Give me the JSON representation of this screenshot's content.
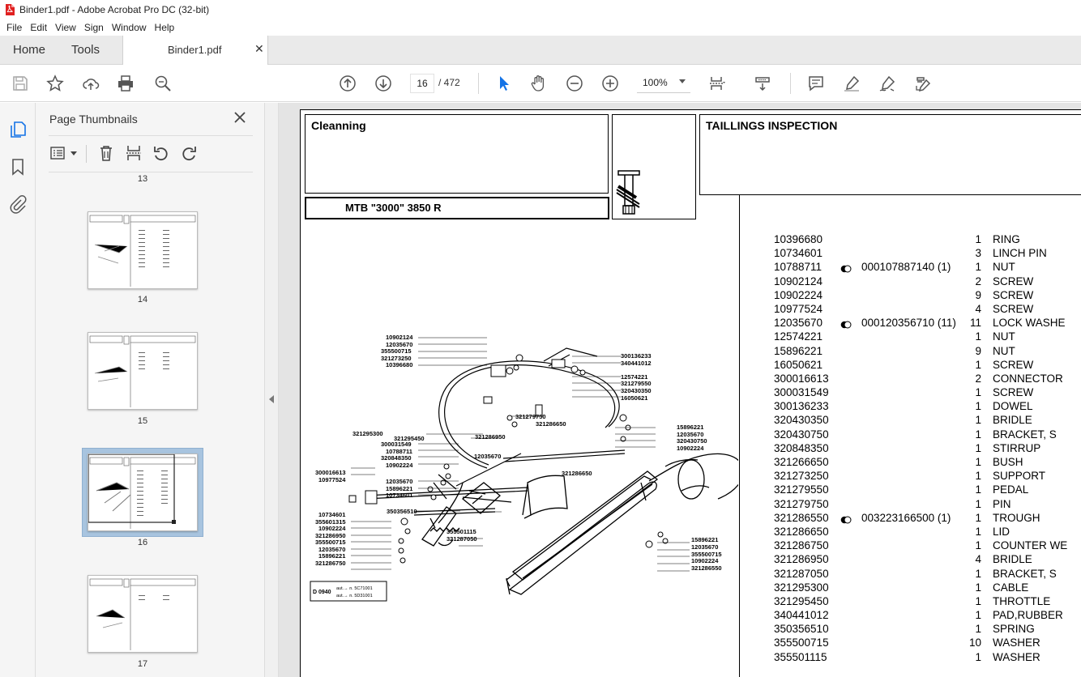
{
  "window": {
    "title": "Binder1.pdf - Adobe Acrobat Pro DC (32-bit)"
  },
  "menu": [
    "File",
    "Edit",
    "View",
    "Sign",
    "Window",
    "Help"
  ],
  "tabs": {
    "home": "Home",
    "tools": "Tools",
    "document": "Binder1.pdf"
  },
  "toolbar": {
    "current_page": "16",
    "page_of": "/  472",
    "zoom": "100%"
  },
  "panel": {
    "title": "Page Thumbnails",
    "thumbnails": [
      {
        "label": "13"
      },
      {
        "label": "14"
      },
      {
        "label": "15"
      },
      {
        "label": "16",
        "selected": true
      },
      {
        "label": "17"
      }
    ]
  },
  "document": {
    "header_left": "Cleanning",
    "header_right": "TAILLINGS INSPECTION",
    "model": "MTB \"3000\" 3850 R",
    "diagram_code": "D 0940",
    "diagram_notes": [
      "aut.→ n. 5C71001",
      "aut.→ n. 5D31001"
    ],
    "diagram_labels": [
      "10902124",
      "12035670",
      "355500715",
      "321273250",
      "10396680",
      "300136233",
      "340441012",
      "12574221",
      "321279550",
      "320430350",
      "16050621",
      "321279750",
      "321286650",
      "321295300",
      "321295450",
      "321286950",
      "12035670",
      "15896221",
      "12035670",
      "320430750",
      "10902224",
      "300031549",
      "10788711",
      "320848350",
      "10902224",
      "300016613",
      "10977524",
      "12035670",
      "15896221",
      "10734601",
      "321286650",
      "350356510",
      "10734601",
      "355601315",
      "10902224",
      "321286950",
      "355500715",
      "12035670",
      "15896221",
      "321286750",
      "355501115",
      "321287050",
      "15896221",
      "12035670",
      "355500715",
      "10902224",
      "321286550"
    ],
    "parts": [
      {
        "num": "10396680",
        "marker": false,
        "ref": "",
        "qty": "1",
        "desc": "RING"
      },
      {
        "num": "10734601",
        "marker": false,
        "ref": "",
        "qty": "3",
        "desc": "LINCH PIN"
      },
      {
        "num": "10788711",
        "marker": true,
        "ref": "000107887140  (1)",
        "qty": "1",
        "desc": "NUT"
      },
      {
        "num": "10902124",
        "marker": false,
        "ref": "",
        "qty": "2",
        "desc": "SCREW"
      },
      {
        "num": "10902224",
        "marker": false,
        "ref": "",
        "qty": "9",
        "desc": "SCREW"
      },
      {
        "num": "10977524",
        "marker": false,
        "ref": "",
        "qty": "4",
        "desc": "SCREW"
      },
      {
        "num": "12035670",
        "marker": true,
        "ref": "000120356710  (11)",
        "qty": "11",
        "desc": "LOCK WASHE"
      },
      {
        "num": "12574221",
        "marker": false,
        "ref": "",
        "qty": "1",
        "desc": "NUT"
      },
      {
        "num": "15896221",
        "marker": false,
        "ref": "",
        "qty": "9",
        "desc": "NUT"
      },
      {
        "num": "16050621",
        "marker": false,
        "ref": "",
        "qty": "1",
        "desc": "SCREW"
      },
      {
        "num": "300016613",
        "marker": false,
        "ref": "",
        "qty": "2",
        "desc": "CONNECTOR"
      },
      {
        "num": "300031549",
        "marker": false,
        "ref": "",
        "qty": "1",
        "desc": "SCREW"
      },
      {
        "num": "300136233",
        "marker": false,
        "ref": "",
        "qty": "1",
        "desc": "DOWEL"
      },
      {
        "num": "320430350",
        "marker": false,
        "ref": "",
        "qty": "1",
        "desc": "BRIDLE"
      },
      {
        "num": "320430750",
        "marker": false,
        "ref": "",
        "qty": "1",
        "desc": "BRACKET, S"
      },
      {
        "num": "320848350",
        "marker": false,
        "ref": "",
        "qty": "1",
        "desc": "STIRRUP"
      },
      {
        "num": "321266650",
        "marker": false,
        "ref": "",
        "qty": "1",
        "desc": "BUSH"
      },
      {
        "num": "321273250",
        "marker": false,
        "ref": "",
        "qty": "1",
        "desc": "SUPPORT"
      },
      {
        "num": "321279550",
        "marker": false,
        "ref": "",
        "qty": "1",
        "desc": "PEDAL"
      },
      {
        "num": "321279750",
        "marker": false,
        "ref": "",
        "qty": "1",
        "desc": "PIN"
      },
      {
        "num": "321286550",
        "marker": true,
        "ref": "003223166500  (1)",
        "qty": "1",
        "desc": "TROUGH"
      },
      {
        "num": "321286650",
        "marker": false,
        "ref": "",
        "qty": "1",
        "desc": "LID"
      },
      {
        "num": "321286750",
        "marker": false,
        "ref": "",
        "qty": "1",
        "desc": "COUNTER WE"
      },
      {
        "num": "321286950",
        "marker": false,
        "ref": "",
        "qty": "4",
        "desc": "BRIDLE"
      },
      {
        "num": "321287050",
        "marker": false,
        "ref": "",
        "qty": "1",
        "desc": "BRACKET, S"
      },
      {
        "num": "321295300",
        "marker": false,
        "ref": "",
        "qty": "1",
        "desc": "CABLE"
      },
      {
        "num": "321295450",
        "marker": false,
        "ref": "",
        "qty": "1",
        "desc": "THROTTLE"
      },
      {
        "num": "340441012",
        "marker": false,
        "ref": "",
        "qty": "1",
        "desc": "PAD,RUBBER"
      },
      {
        "num": "350356510",
        "marker": false,
        "ref": "",
        "qty": "1",
        "desc": "SPRING"
      },
      {
        "num": "355500715",
        "marker": false,
        "ref": "",
        "qty": "10",
        "desc": "WASHER"
      },
      {
        "num": "355501115",
        "marker": false,
        "ref": "",
        "qty": "1",
        "desc": "WASHER"
      }
    ]
  },
  "icons": {
    "toolbar": [
      "save-icon",
      "bookmark-star-icon",
      "upload-icon",
      "print-icon",
      "zoom-search-icon",
      "page-up-icon",
      "page-down-icon",
      "select-cursor-icon",
      "hand-icon",
      "zoom-out-icon",
      "zoom-in-icon",
      "page-fit-icon",
      "scroll-mode-icon",
      "comment-icon",
      "highlight-icon",
      "sign-icon",
      "edit-icon"
    ],
    "rail": [
      "page-thumbnails-icon",
      "bookmarks-icon",
      "attachments-icon"
    ]
  },
  "colors": {
    "accent": "#1473e6",
    "selection": "#a8c4df",
    "pdf_red": "#e02020"
  }
}
